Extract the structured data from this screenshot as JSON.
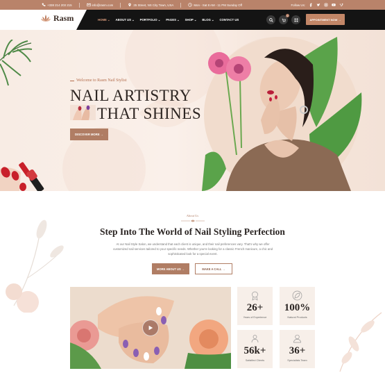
{
  "topbar": {
    "phone": "+338 214 203 215",
    "email": "info@rasm.com",
    "address": "25 Street, NS City Town, USA",
    "hours": "Mon - Sat 8 AM - 11 PM Sunday Off",
    "follow_label": "Follow Us:",
    "social_icons": [
      "facebook-icon",
      "twitter-icon",
      "instagram-icon",
      "youtube-icon",
      "vimeo-icon"
    ]
  },
  "header": {
    "brand": "Rasm",
    "menu": [
      {
        "label": "HOME",
        "active": true
      },
      {
        "label": "ABOUT US",
        "active": false
      },
      {
        "label": "PORTFOLIO",
        "active": false
      },
      {
        "label": "PAGES",
        "active": false
      },
      {
        "label": "SHOP",
        "active": false
      },
      {
        "label": "BLOG",
        "active": false
      },
      {
        "label": "CONTACT US",
        "active": false
      }
    ],
    "cart_count": "0",
    "appointment_label": "APPOINTMENT NOW"
  },
  "hero": {
    "welcome": "Welcome to Rasm Nail Stylist",
    "title_line1": "NAIL ARTISTRY",
    "title_line2": "THAT SHINES",
    "cta": "DISCOVER MORE"
  },
  "about": {
    "subtitle": "About Us",
    "title": "Step Into The World of Nail Styling Perfection",
    "paragraph": "At our Nail Style Salon, we understand that each client is unique, and their nail preferences vary. That's why we offer customized nail services tailored to your specific needs. Whether you're looking for a classic French manicure, a chic and sophisticated look for a special event.",
    "more_button": "MORE ABOUT US",
    "call_button": "MAKE A CALL"
  },
  "stats": [
    {
      "value": "26+",
      "label": "Years of Experience",
      "icon": "award-icon"
    },
    {
      "value": "100%",
      "label": "Natural Products",
      "icon": "leaf-icon"
    },
    {
      "value": "56k+",
      "label": "Satisfied Clients",
      "icon": "clients-icon"
    },
    {
      "value": "36+",
      "label": "Specialists Team",
      "icon": "specialist-icon"
    }
  ],
  "colors": {
    "accent": "#b9836a",
    "button": "#b07d64",
    "nav_bg": "#141414",
    "hero_bg": "#f8ece4"
  }
}
